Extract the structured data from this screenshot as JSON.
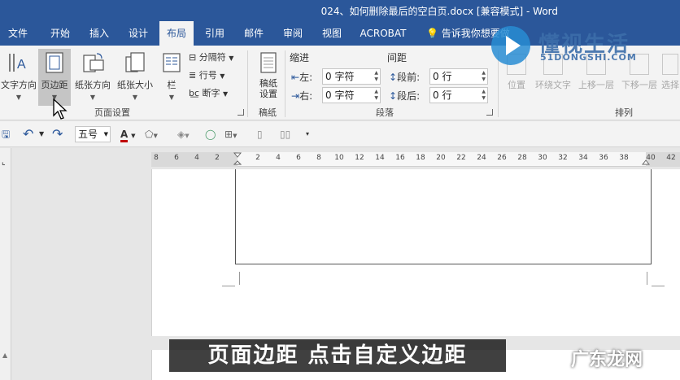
{
  "window": {
    "title": "024、如何删除最后的空白页.docx [兼容模式] - Word"
  },
  "tabs": [
    {
      "label": "文件"
    },
    {
      "label": "开始"
    },
    {
      "label": "插入"
    },
    {
      "label": "设计"
    },
    {
      "label": "布局"
    },
    {
      "label": "引用"
    },
    {
      "label": "邮件"
    },
    {
      "label": "审阅"
    },
    {
      "label": "视图"
    },
    {
      "label": "ACROBAT"
    }
  ],
  "active_tab": "布局",
  "tell_me": "告诉我你想要做",
  "watermark": {
    "name": "懂视生活",
    "domain": "51DONGSHI.COM",
    "brand": "广东龙网"
  },
  "ribbon": {
    "page_setup": {
      "text_direction": "文字方向",
      "margins": "页边距",
      "orientation": "纸张方向",
      "size": "纸张大小",
      "columns": "栏",
      "breaks": "分隔符",
      "line_numbers": "行号",
      "hyphenation": "断字",
      "group_label": "页面设置"
    },
    "draft": {
      "button": "稿纸设置",
      "group_label": "稿纸"
    },
    "paragraph": {
      "indent_heading": "缩进",
      "spacing_heading": "间距",
      "left_label": "左:",
      "left_value": "0 字符",
      "right_label": "右:",
      "right_value": "0 字符",
      "before_label": "段前:",
      "before_value": "0 行",
      "after_label": "段后:",
      "after_value": "0 行",
      "group_label": "段落"
    },
    "arrange": {
      "position": "位置",
      "wrap_text": "环绕文字",
      "bring_forward": "上移一层",
      "send_backward": "下移一层",
      "select": "选择",
      "group_label": "排列"
    }
  },
  "quick_access": {
    "font_size": "五号"
  },
  "ruler": {
    "ticks": [
      "8",
      "6",
      "4",
      "2",
      "2",
      "4",
      "6",
      "8",
      "10",
      "12",
      "14",
      "16",
      "18",
      "20",
      "22",
      "24",
      "26",
      "28",
      "30",
      "32",
      "34",
      "36",
      "38",
      "40",
      "42"
    ]
  },
  "subtitle": "页面边距 点击自定义边距",
  "colors": {
    "accent": "#2b579a",
    "ribbon_bg": "#f3f3f3",
    "font_color_underline": "#c00000"
  }
}
